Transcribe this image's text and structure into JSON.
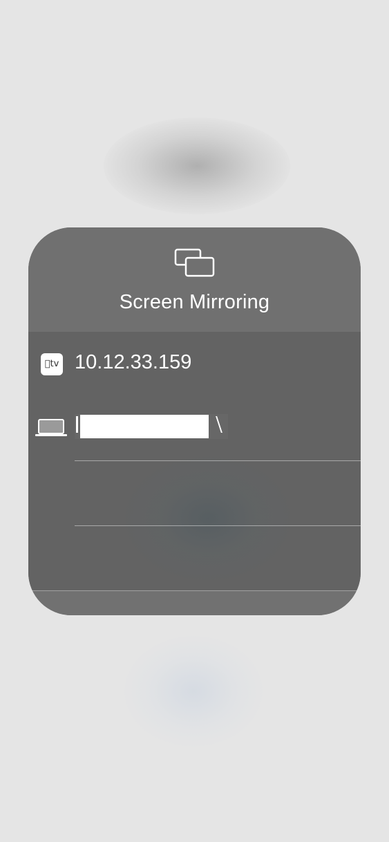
{
  "panel": {
    "title": "Screen Mirroring",
    "icon": "screen-mirroring-icon"
  },
  "devices": [
    {
      "name": "10.12.33.159",
      "icon": "apple-tv-icon",
      "icon_text": "tv"
    },
    {
      "name": "",
      "icon": "laptop-icon",
      "redacted": true
    }
  ],
  "colors": {
    "panel_background": "#666666",
    "header_background": "#707070",
    "text": "#ffffff",
    "page_background": "#e5e5e5"
  }
}
